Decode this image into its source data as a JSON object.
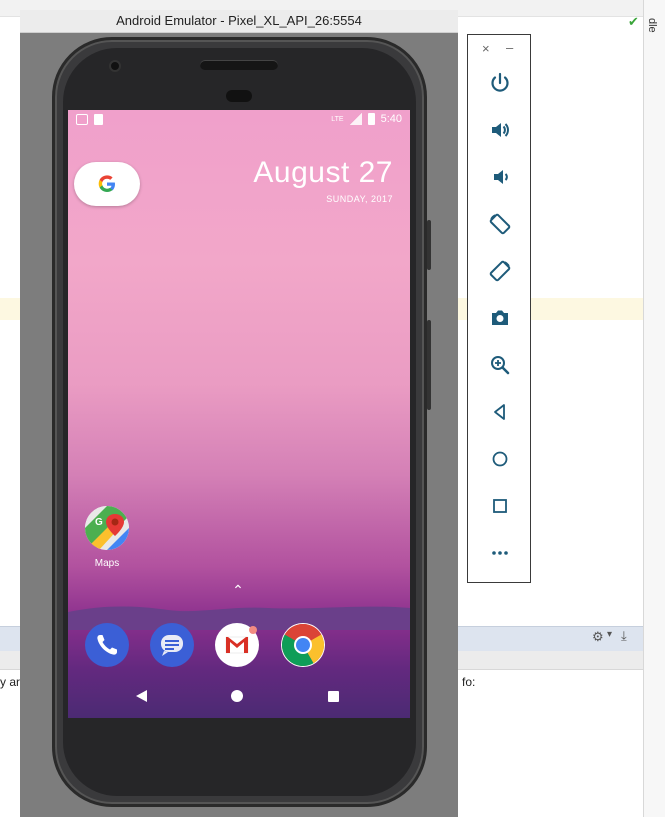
{
  "emulator": {
    "title": "Android Emulator - Pixel_XL_API_26:5554"
  },
  "ide": {
    "right_label": "dle",
    "left_text": "y ar",
    "right_text": "fo:"
  },
  "status_bar": {
    "time": "5:40",
    "network": "LTE"
  },
  "home": {
    "date_main": "August 27",
    "date_sub": "SUNDAY, 2017",
    "google_glyph": "G",
    "maps_label": "Maps"
  },
  "toolbar": {
    "close_glyph": "×",
    "minimize_glyph": "–",
    "buttons": [
      "power",
      "volume-up",
      "volume-down",
      "rotate-left",
      "rotate-right",
      "screenshot",
      "zoom",
      "back",
      "home",
      "overview",
      "more"
    ]
  },
  "colors": {
    "toolbar_icon": "#1e5b7a",
    "check": "#3aa53a"
  }
}
